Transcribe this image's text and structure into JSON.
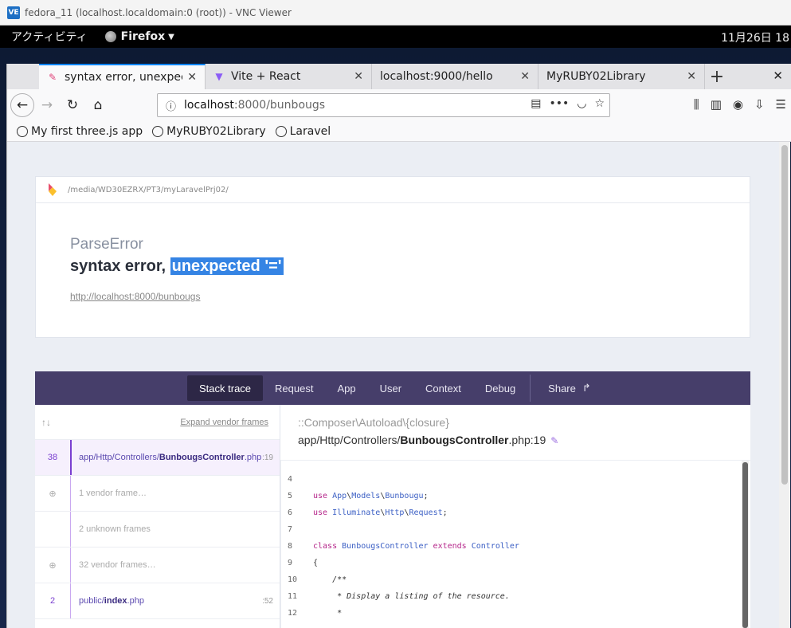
{
  "vnc": {
    "title": "fedora_11 (localhost.localdomain:0 (root)) - VNC Viewer",
    "icon": "VE"
  },
  "gnome": {
    "activities": "アクティビティ",
    "app": "Firefox",
    "clock": "11月26日 18"
  },
  "browser": {
    "tabs": [
      {
        "label": "syntax error, unexpected",
        "icon": "pencil-icon"
      },
      {
        "label": "Vite + React",
        "icon": "vite-icon"
      },
      {
        "label": "localhost:9000/hello",
        "icon": ""
      },
      {
        "label": "MyRUBY02Library",
        "icon": ""
      }
    ],
    "url_host": "localhost",
    "url_rest": ":8000/bunbougs",
    "bookmarks": [
      "My first three.js app",
      "MyRUBY02Library",
      "Laravel"
    ]
  },
  "error": {
    "path": "/media/WD30EZRX/PT3/myLaravelPrj02/",
    "type": "ParseError",
    "message_prefix": "syntax error, ",
    "message_highlight": "unexpected '='",
    "url": "http://localhost:8000/bunbougs"
  },
  "stack_nav": {
    "tabs": [
      "Stack trace",
      "Request",
      "App",
      "User",
      "Context",
      "Debug"
    ],
    "share": "Share"
  },
  "frames": {
    "expand_label": "Expand vendor frames",
    "items": [
      {
        "num": "38",
        "path_prefix": "app/Http/Controllers/",
        "path_bold": "BunbougsController",
        "path_ext": ".php",
        "pos": ":19",
        "selected": true
      },
      {
        "vendor": "1 vendor frame…"
      },
      {
        "vendor": "2 unknown frames"
      },
      {
        "vendor": "32 vendor frames…"
      },
      {
        "num": "2",
        "path_prefix": "public/",
        "path_bold": "index",
        "path_ext": ".php",
        "pos": ":52"
      }
    ]
  },
  "code": {
    "class": "::Composer\\Autoload\\{closure}",
    "file_prefix": "app/Http/Controllers/",
    "file_bold": "BunbougsController",
    "file_ext": ".php:19",
    "lines": [
      {
        "n": "4",
        "t": ""
      },
      {
        "n": "5",
        "t": "use App\\Models\\Bunbougu;"
      },
      {
        "n": "6",
        "t": "use Illuminate\\Http\\Request;"
      },
      {
        "n": "7",
        "t": ""
      },
      {
        "n": "8",
        "t": "class BunbougsController extends Controller"
      },
      {
        "n": "9",
        "t": "{"
      },
      {
        "n": "10",
        "t": "    /**"
      },
      {
        "n": "11",
        "t": "     * Display a listing of the resource."
      },
      {
        "n": "12",
        "t": "     *"
      }
    ]
  }
}
